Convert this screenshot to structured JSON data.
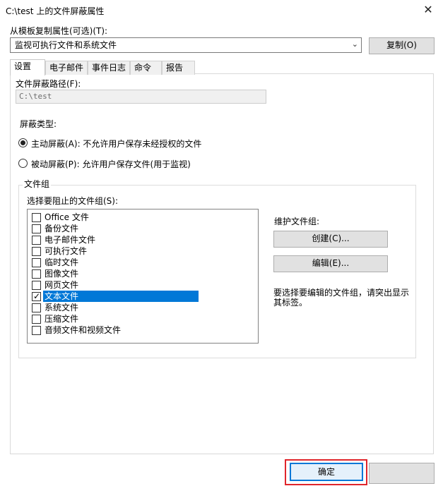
{
  "window": {
    "title": "C:\\test 上的文件屏蔽属性",
    "close_glyph": "✕"
  },
  "template": {
    "label": "从模板复制属性(可选)(T):",
    "selected": "监视可执行文件和系统文件",
    "copy_button": "复制(O)"
  },
  "tabs": [
    {
      "label": "设置",
      "active": true
    },
    {
      "label": "电子邮件",
      "active": false
    },
    {
      "label": "事件日志",
      "active": false
    },
    {
      "label": "命令",
      "active": false
    },
    {
      "label": "报告",
      "active": false
    }
  ],
  "settings": {
    "path_label": "文件屏蔽路径(F):",
    "path_value": "C:\\test",
    "type_label": "屏蔽类型:",
    "active_screening": "主动屏蔽(A): 不允许用户保存未经授权的文件",
    "passive_screening": "被动屏蔽(P): 允许用户保存文件(用于监视)",
    "selected_type": "active"
  },
  "file_groups": {
    "group_title": "文件组",
    "list_label": "选择要阻止的文件组(S):",
    "items": [
      {
        "label": "Office 文件",
        "checked": false
      },
      {
        "label": "备份文件",
        "checked": false
      },
      {
        "label": "电子邮件文件",
        "checked": false
      },
      {
        "label": "可执行文件",
        "checked": false
      },
      {
        "label": "临时文件",
        "checked": false
      },
      {
        "label": "图像文件",
        "checked": false
      },
      {
        "label": "网页文件",
        "checked": false
      },
      {
        "label": "文本文件",
        "checked": true,
        "selected": true
      },
      {
        "label": "系统文件",
        "checked": false
      },
      {
        "label": "压缩文件",
        "checked": false
      },
      {
        "label": "音频文件和视频文件",
        "checked": false
      }
    ],
    "maintain_label": "维护文件组:",
    "create_button": "创建(C)...",
    "edit_button": "编辑(E)...",
    "help_text": "要选择要编辑的文件组，请突出显示其标签。"
  },
  "footer": {
    "ok_button": "确定"
  },
  "colors": {
    "selection": "#0078d7",
    "highlight_frame": "#e0252b"
  }
}
